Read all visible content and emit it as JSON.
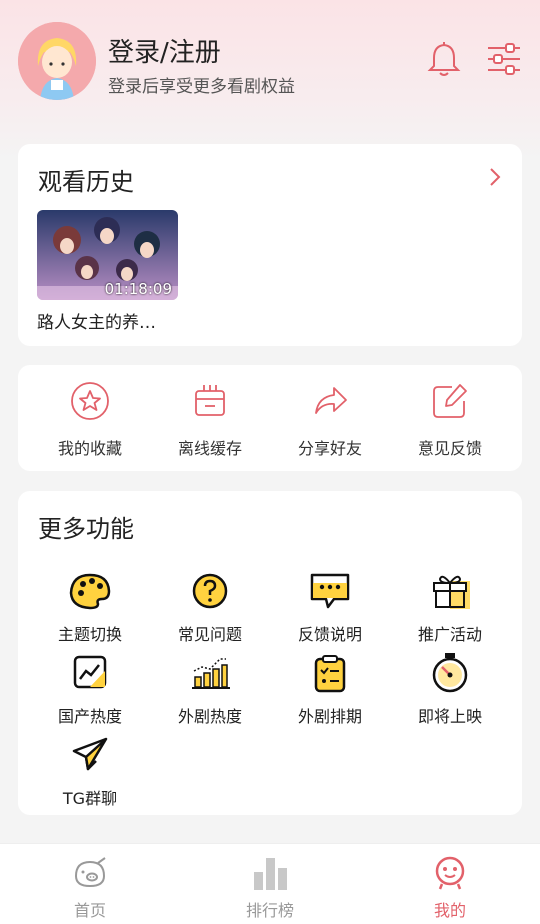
{
  "profile": {
    "title": "登录/注册",
    "subtitle": "登录后享受更多看剧权益"
  },
  "history": {
    "title": "观看历史",
    "items": [
      {
        "title": "路人女主的养…",
        "time": "01:18:09"
      }
    ]
  },
  "quick_actions": [
    {
      "label": "我的收藏",
      "icon": "star-icon"
    },
    {
      "label": "离线缓存",
      "icon": "download-box-icon"
    },
    {
      "label": "分享好友",
      "icon": "share-icon"
    },
    {
      "label": "意见反馈",
      "icon": "edit-icon"
    }
  ],
  "more": {
    "title": "更多功能",
    "items": [
      {
        "label": "主题切换",
        "icon": "palette-icon"
      },
      {
        "label": "常见问题",
        "icon": "question-icon"
      },
      {
        "label": "反馈说明",
        "icon": "chat-bubble-icon"
      },
      {
        "label": "推广活动",
        "icon": "gift-icon"
      },
      {
        "label": "国产热度",
        "icon": "trend-chart-icon"
      },
      {
        "label": "外剧热度",
        "icon": "bar-chart-icon"
      },
      {
        "label": "外剧排期",
        "icon": "clipboard-icon"
      },
      {
        "label": "即将上映",
        "icon": "stopwatch-icon"
      },
      {
        "label": "TG群聊",
        "icon": "telegram-icon"
      }
    ]
  },
  "tabs": [
    {
      "label": "首页",
      "icon": "home-pig-icon",
      "active": false
    },
    {
      "label": "排行榜",
      "icon": "ranking-icon",
      "active": false
    },
    {
      "label": "我的",
      "icon": "profile-face-icon",
      "active": true
    }
  ],
  "colors": {
    "accent": "#e2616a",
    "header_bg": "#fbe3e6",
    "yellow": "#ffd23f"
  }
}
